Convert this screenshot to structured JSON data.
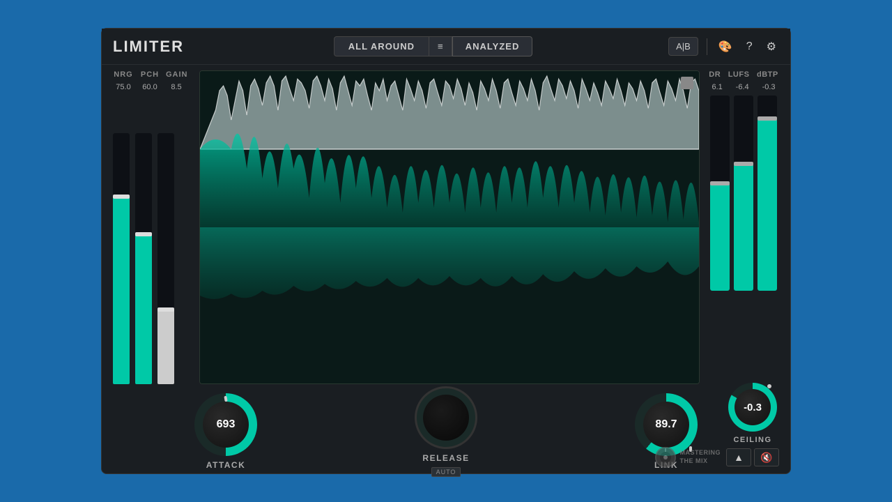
{
  "header": {
    "logo": "LIMITER",
    "preset": "ALL AROUND",
    "analyzed": "ANALYZED",
    "ab_label": "A|B"
  },
  "meters_left": {
    "labels": [
      "NRG",
      "PCH",
      "GAIN"
    ],
    "values": [
      "75.0",
      "60.0",
      "8.5"
    ]
  },
  "meters_right": {
    "labels": [
      "DR",
      "LUFS",
      "dBTP"
    ],
    "values": [
      "6.1",
      "-6.4",
      "-0.3"
    ]
  },
  "knobs": {
    "attack": {
      "label": "ATTACK",
      "value": "693"
    },
    "release": {
      "label": "RELEASE",
      "value": "",
      "badge": "AUTO"
    },
    "link": {
      "label": "LINK",
      "value": "89.7"
    }
  },
  "ceiling": {
    "label": "CEILING",
    "value": "-0.3"
  },
  "brand": {
    "line1": "MASTERING",
    "line2": "THE MIX"
  }
}
